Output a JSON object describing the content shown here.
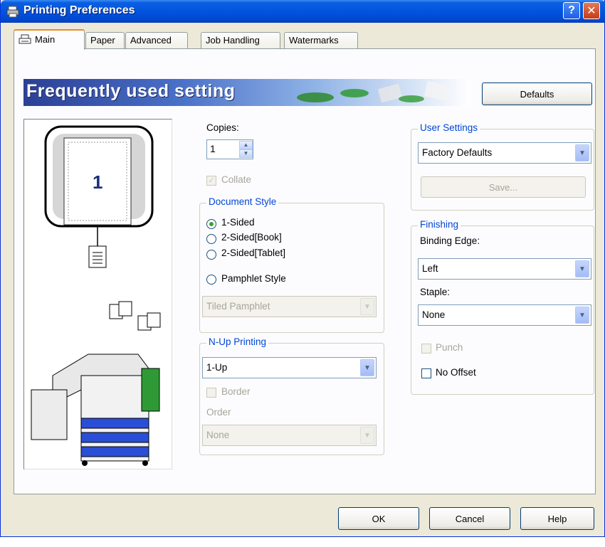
{
  "window": {
    "title": "Printing Preferences",
    "help_glyph": "?",
    "close_glyph": "✕"
  },
  "tabs": [
    {
      "label": "Main",
      "active": true
    },
    {
      "label": "Paper"
    },
    {
      "label": "Advanced"
    },
    {
      "label": "Job Handling"
    },
    {
      "label": "Watermarks"
    }
  ],
  "banner": {
    "text": "Frequently used setting",
    "defaults_button": "Defaults"
  },
  "preview": {
    "page_number": "1"
  },
  "copies": {
    "label": "Copies:",
    "value": "1",
    "collate_label": "Collate",
    "collate_checked": true,
    "collate_enabled": false
  },
  "document_style": {
    "title": "Document Style",
    "options": [
      "1-Sided",
      "2-Sided[Book]",
      "2-Sided[Tablet]",
      "Pamphlet Style"
    ],
    "selected": "1-Sided",
    "pamphlet_select": "Tiled Pamphlet"
  },
  "nup": {
    "title": "N-Up Printing",
    "value": "1-Up",
    "border_label": "Border",
    "order_label": "Order",
    "order_value": "None"
  },
  "user_settings": {
    "title": "User Settings",
    "value": "Factory Defaults",
    "save_button": "Save..."
  },
  "finishing": {
    "title": "Finishing",
    "binding_edge_label": "Binding Edge:",
    "binding_edge_value": "Left",
    "staple_label": "Staple:",
    "staple_value": "None",
    "punch_label": "Punch",
    "no_offset_label": "No Offset"
  },
  "footer": {
    "ok": "OK",
    "cancel": "Cancel",
    "help": "Help"
  },
  "colors": {
    "title_bar": "#0254e0",
    "dialog_bg": "#ece9d8",
    "group_title": "#0046d5",
    "radio_dot": "#35a432"
  }
}
